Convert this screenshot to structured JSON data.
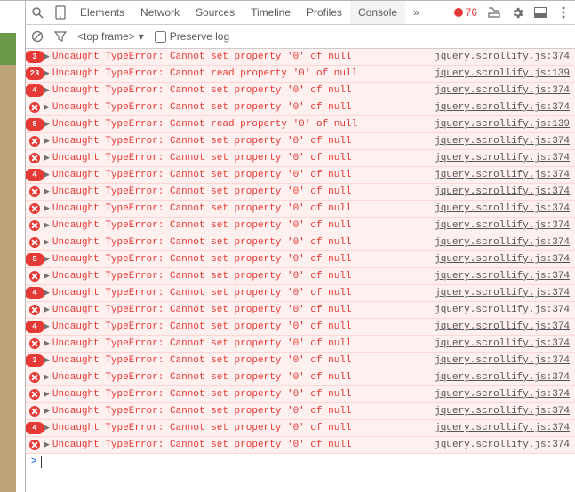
{
  "tabs": {
    "items": [
      "Elements",
      "Network",
      "Sources",
      "Timeline",
      "Profiles",
      "Console"
    ],
    "active": 5,
    "more": "»",
    "error_count": "76"
  },
  "toolbar": {
    "frame": "<top frame>",
    "preserve_label": "Preserve log"
  },
  "prompt_symbol": ">",
  "errors": [
    {
      "count": "3",
      "msg": "Uncaught TypeError: Cannot set property '0' of null",
      "src": "jquery.scrollify.js:374"
    },
    {
      "count": "23",
      "msg": "Uncaught TypeError: Cannot read property '0' of null",
      "src": "jquery.scrollify.js:139"
    },
    {
      "count": "4",
      "msg": "Uncaught TypeError: Cannot set property '0' of null",
      "src": "jquery.scrollify.js:374"
    },
    {
      "count": null,
      "msg": "Uncaught TypeError: Cannot set property '0' of null",
      "src": "jquery.scrollify.js:374"
    },
    {
      "count": "9",
      "msg": "Uncaught TypeError: Cannot read property '0' of null",
      "src": "jquery.scrollify.js:139"
    },
    {
      "count": null,
      "msg": "Uncaught TypeError: Cannot set property '0' of null",
      "src": "jquery.scrollify.js:374"
    },
    {
      "count": null,
      "msg": "Uncaught TypeError: Cannot set property '0' of null",
      "src": "jquery.scrollify.js:374"
    },
    {
      "count": "4",
      "msg": "Uncaught TypeError: Cannot set property '0' of null",
      "src": "jquery.scrollify.js:374"
    },
    {
      "count": null,
      "msg": "Uncaught TypeError: Cannot set property '0' of null",
      "src": "jquery.scrollify.js:374"
    },
    {
      "count": null,
      "msg": "Uncaught TypeError: Cannot set property '0' of null",
      "src": "jquery.scrollify.js:374"
    },
    {
      "count": null,
      "msg": "Uncaught TypeError: Cannot set property '0' of null",
      "src": "jquery.scrollify.js:374"
    },
    {
      "count": null,
      "msg": "Uncaught TypeError: Cannot set property '0' of null",
      "src": "jquery.scrollify.js:374"
    },
    {
      "count": "5",
      "msg": "Uncaught TypeError: Cannot set property '0' of null",
      "src": "jquery.scrollify.js:374"
    },
    {
      "count": null,
      "msg": "Uncaught TypeError: Cannot set property '0' of null",
      "src": "jquery.scrollify.js:374"
    },
    {
      "count": "4",
      "msg": "Uncaught TypeError: Cannot set property '0' of null",
      "src": "jquery.scrollify.js:374"
    },
    {
      "count": null,
      "msg": "Uncaught TypeError: Cannot set property '0' of null",
      "src": "jquery.scrollify.js:374"
    },
    {
      "count": "4",
      "msg": "Uncaught TypeError: Cannot set property '0' of null",
      "src": "jquery.scrollify.js:374"
    },
    {
      "count": null,
      "msg": "Uncaught TypeError: Cannot set property '0' of null",
      "src": "jquery.scrollify.js:374"
    },
    {
      "count": "3",
      "msg": "Uncaught TypeError: Cannot set property '0' of null",
      "src": "jquery.scrollify.js:374"
    },
    {
      "count": null,
      "msg": "Uncaught TypeError: Cannot set property '0' of null",
      "src": "jquery.scrollify.js:374"
    },
    {
      "count": null,
      "msg": "Uncaught TypeError: Cannot set property '0' of null",
      "src": "jquery.scrollify.js:374"
    },
    {
      "count": null,
      "msg": "Uncaught TypeError: Cannot set property '0' of null",
      "src": "jquery.scrollify.js:374"
    },
    {
      "count": "4",
      "msg": "Uncaught TypeError: Cannot set property '0' of null",
      "src": "jquery.scrollify.js:374"
    },
    {
      "count": null,
      "msg": "Uncaught TypeError: Cannot set property '0' of null",
      "src": "jquery.scrollify.js:374"
    }
  ]
}
